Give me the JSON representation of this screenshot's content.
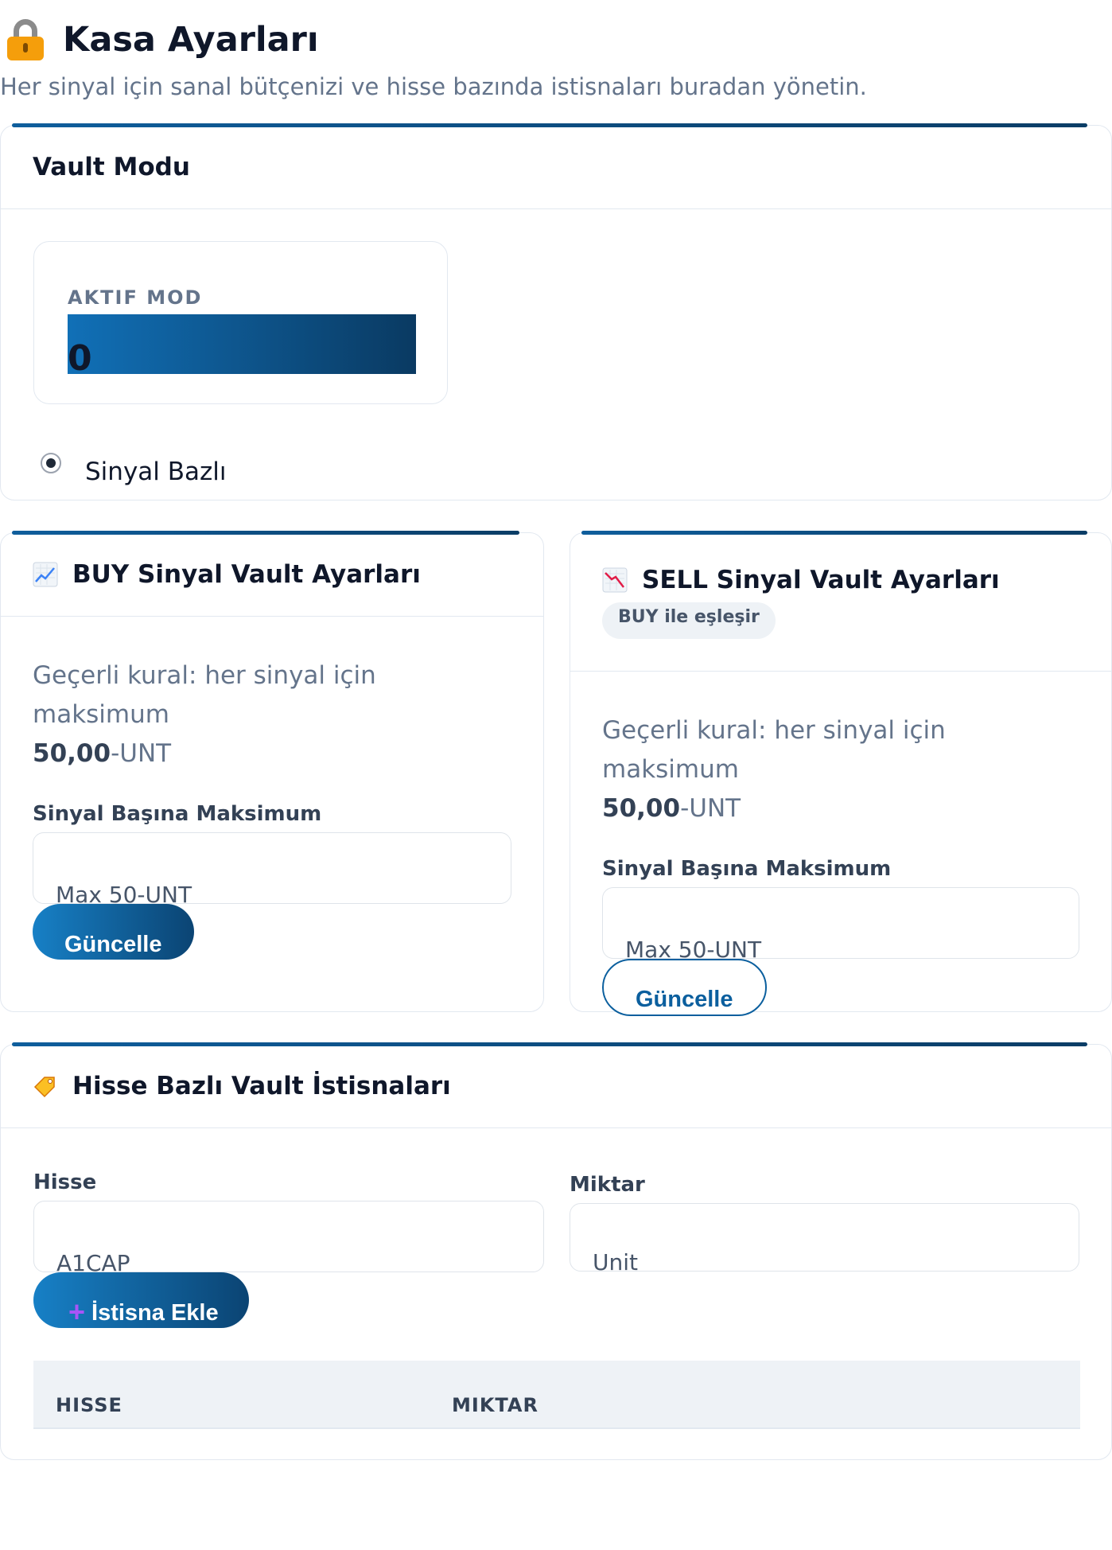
{
  "header": {
    "title": "Kasa Ayarları",
    "subtitle": "Her sinyal için sanal bütçenizi ve hisse bazında istisnaları buradan yönetin."
  },
  "vault_mode": {
    "title": "Vault Modu",
    "active_label": "AKTIF MOD",
    "active_value": "0",
    "radio_label": "Sinyal Bazlı",
    "radio_selected": true
  },
  "buy": {
    "title": "BUY Sinyal Vault Ayarları",
    "icon": "chart-increasing-icon",
    "rule_prefix": "Geçerli kural: her sinyal için maksimum",
    "rule_amount": "50,00",
    "rule_unit": "-UNT",
    "field_label": "Sinyal Başına Maksimum",
    "input_placeholder": "Max 50-UNT",
    "button_label": "Güncelle"
  },
  "sell": {
    "title": "SELL Sinyal Vault Ayarları",
    "icon": "chart-decreasing-icon",
    "badge": "BUY ile eşleşir",
    "rule_prefix": "Geçerli kural: her sinyal için maksimum",
    "rule_amount": "50,00",
    "rule_unit": "-UNT",
    "field_label": "Sinyal Başına Maksimum",
    "input_placeholder": "Max 50-UNT",
    "button_label": "Güncelle"
  },
  "exceptions": {
    "title": "Hisse Bazlı Vault İstisnaları",
    "icon": "label-tag-icon",
    "stock_label": "Hisse",
    "stock_placeholder": "A1CAP",
    "amount_label": "Miktar",
    "amount_placeholder": "Unit",
    "add_button": "İstisna Ekle",
    "add_icon": "plus-icon",
    "columns": [
      "HISSE",
      "MIKTAR"
    ]
  },
  "colors": {
    "accent": "#0f5e9c",
    "accent_dark": "#0b3d66",
    "muted_text": "#64748b"
  }
}
